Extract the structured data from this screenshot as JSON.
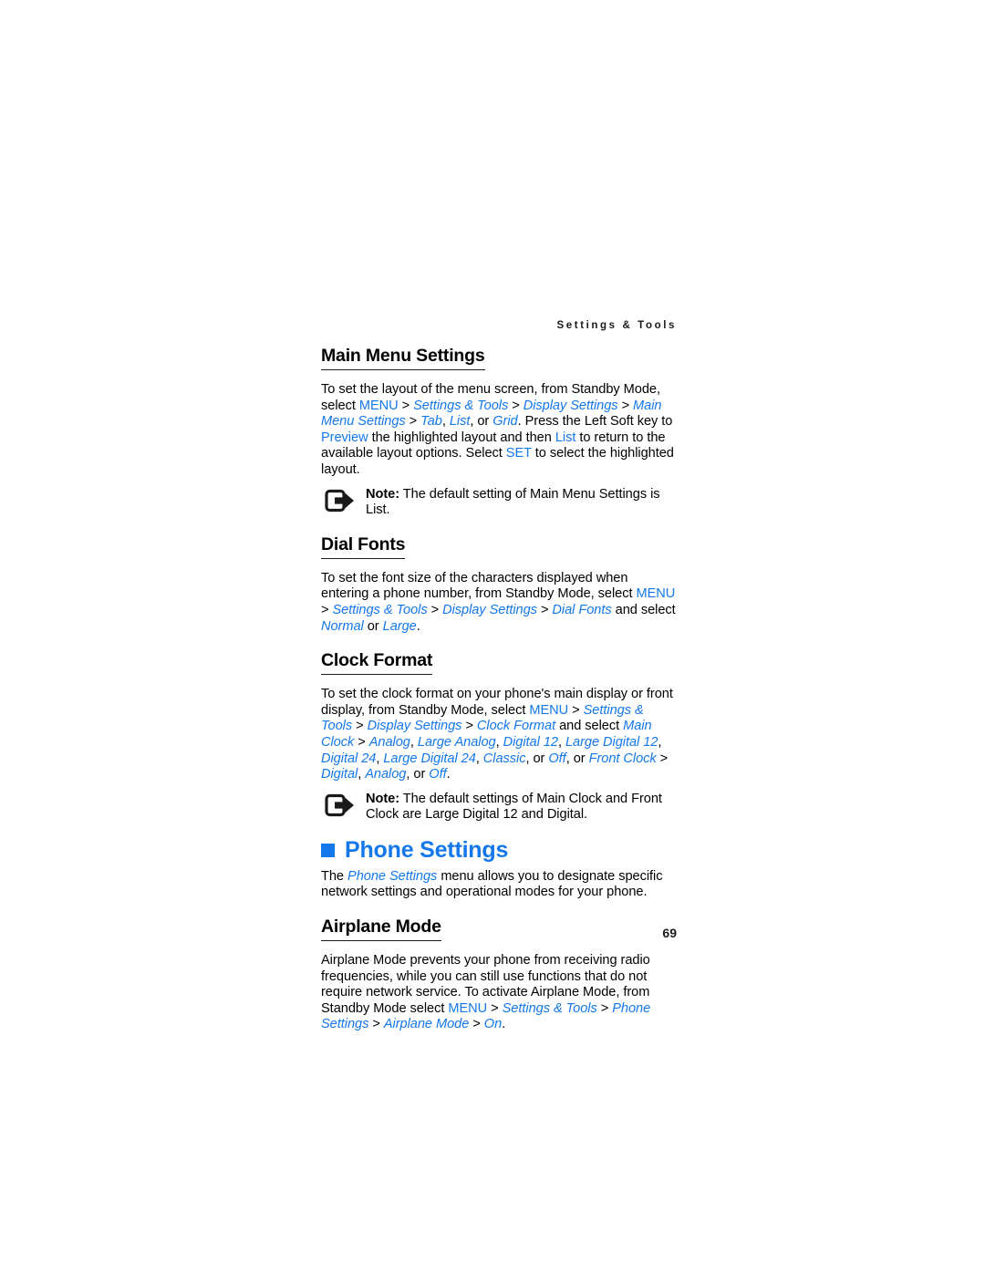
{
  "page": {
    "running_header": "Settings & Tools",
    "folio": "69",
    "accent_color": "#1478ea",
    "text_color": "#000000",
    "background_color": "#ffffff"
  },
  "sections": [
    {
      "id": "main-menu-settings",
      "heading": "Main Menu Settings",
      "paragraph": {
        "l1": "To set the layout of the menu screen, from Standby Mode, select",
        "p1_menu": "MENU",
        "p1_sep1": " > ",
        "p1_settings_tools": "Settings & Tools",
        "p1_sep2": " > ",
        "p1_display_settings": "Display Settings",
        "p1_sep3": " > ",
        "p1_main_menu_settings": "Main Menu Settings",
        "p1_sep4": " > ",
        "p1_tab": "Tab",
        "p1_comma1": ", ",
        "p1_list": "List",
        "p1_or1": ", or ",
        "p1_grid": "Grid",
        "p1_mid": ". Press the Left Soft key to ",
        "p1_preview": "Preview",
        "p1_mid2": " the highlighted layout and then ",
        "p1_list2": "List",
        "p1_mid3": " to return to the available layout options. Select ",
        "p1_set": "SET",
        "p1_end": " to select the highlighted layout."
      },
      "note": {
        "label": "Note:",
        "text": " The default setting of Main Menu Settings is List."
      }
    },
    {
      "id": "dial-fonts",
      "heading": "Dial Fonts",
      "paragraph": {
        "p1_start": "To set the font size of the characters displayed when entering a phone number, from Standby Mode, select ",
        "p1_menu": "MENU",
        "p1_sep1": " > ",
        "p1_settings_tools": "Settings & Tools",
        "p1_sep2": " > ",
        "p1_display_settings": "Display Settings",
        "p1_sep3": " > ",
        "p1_dial_fonts": "Dial Fonts",
        "p1_mid": " and select ",
        "p1_normal": "Normal",
        "p1_or": " or ",
        "p1_large": "Large",
        "p1_end": "."
      }
    },
    {
      "id": "clock-format",
      "heading": "Clock Format",
      "paragraph": {
        "p1_start": "To set the clock format on your phone's main display or front display, from Standby Mode, select ",
        "p1_menu": "MENU",
        "p1_sep1": " > ",
        "p1_settings_tools": "Settings & Tools",
        "p1_sep2": " > ",
        "p1_display_settings": "Display Settings",
        "p1_sep3": " > ",
        "p1_clock_format": "Clock Format",
        "p1_mid": " and select ",
        "p1_main_clock": "Main Clock",
        "p1_sep4": " > ",
        "p1_analog": "Analog",
        "p1_c1": ", ",
        "p1_large_analog": "Large Analog",
        "p1_c2": ", ",
        "p1_digital12": "Digital 12",
        "p1_c3": ", ",
        "p1_large_digital12": "Large Digital 12",
        "p1_c4": ", ",
        "p1_digital24": "Digital 24",
        "p1_c5": ", ",
        "p1_large_digital24": "Large Digital 24",
        "p1_c6": ", ",
        "p1_classic": "Classic",
        "p1_or1": ", or ",
        "p1_off1": "Off",
        "p1_or2": ", or ",
        "p1_front_clock": "Front Clock",
        "p1_sep5": " > ",
        "p1_digital": "Digital",
        "p1_c7": ", ",
        "p1_analog2": "Analog",
        "p1_or3": ", or ",
        "p1_off2": "Off",
        "p1_end": "."
      },
      "note": {
        "label": "Note:",
        "text": " The default settings of Main Clock and Front Clock are Large Digital 12 and Digital."
      }
    },
    {
      "id": "phone-settings",
      "heading": "Phone Settings",
      "paragraph": {
        "p1_start": "The ",
        "p1_phone_settings": "Phone Settings",
        "p1_end": " menu allows you to designate specific network settings and operational modes for your phone."
      }
    },
    {
      "id": "airplane-mode",
      "heading": "Airplane Mode",
      "paragraph": {
        "p1_start": "Airplane Mode prevents your phone from receiving radio frequencies, while you can still use functions that do not require network service. To activate Airplane Mode, from Standby Mode select ",
        "p1_menu": "MENU",
        "p1_sep1": " > ",
        "p1_settings_tools": "Settings & Tools",
        "p1_sep2": " > ",
        "p1_phone_settings": "Phone Settings",
        "p1_sep3": " > ",
        "p1_airplane_mode": "Airplane Mode",
        "p1_sep4": " > ",
        "p1_on": "On",
        "p1_end": "."
      }
    }
  ],
  "icons": {
    "note_icon": "note-arrow-icon",
    "chapter_bullet": "square-bullet-icon"
  }
}
